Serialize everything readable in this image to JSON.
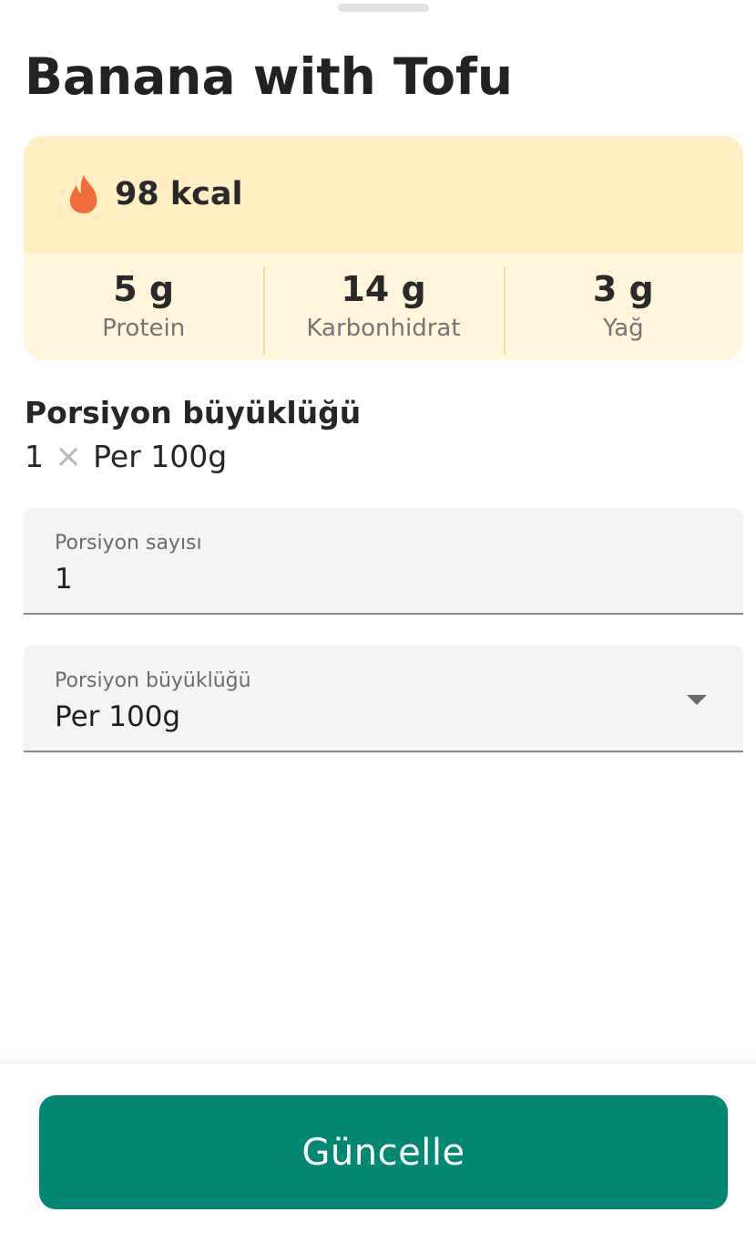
{
  "food": {
    "title": "Banana with Tofu"
  },
  "nutrition": {
    "kcal": "98 kcal",
    "icon": "flame-icon",
    "macros": [
      {
        "value": "5 g",
        "label": "Protein"
      },
      {
        "value": "14 g",
        "label": "Karbonhidrat"
      },
      {
        "value": "3 g",
        "label": "Yağ"
      }
    ]
  },
  "serving": {
    "heading": "Porsiyon büyüklüğü",
    "summary_count": "1",
    "summary_unit": "Per 100g",
    "times_icon": "×"
  },
  "fields": {
    "servings_count": {
      "label": "Porsiyon sayısı",
      "value": "1"
    },
    "serving_size": {
      "label": "Porsiyon büyüklüğü",
      "value": "Per 100g"
    }
  },
  "actions": {
    "update_label": "Güncelle"
  },
  "colors": {
    "accent": "#018774",
    "card_top": "#ffefc2",
    "card_bottom": "#fff6dc",
    "flame": "#f26b3a"
  }
}
